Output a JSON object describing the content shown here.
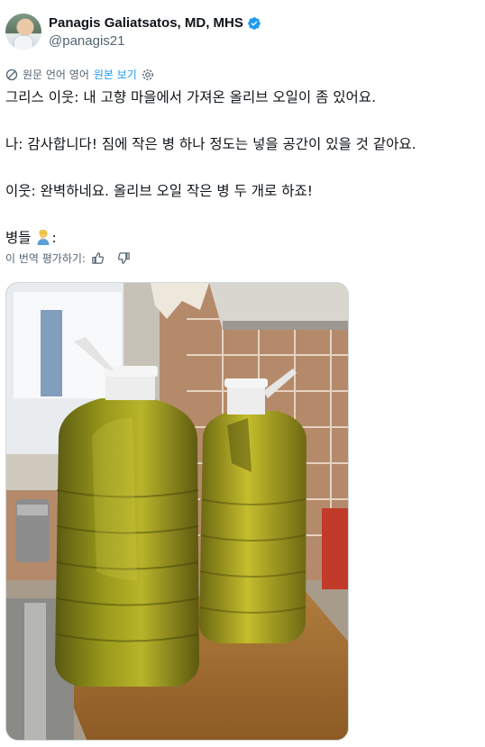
{
  "author": {
    "name": "Panagis Galiatsatos, MD, MHS",
    "handle": "@panagis21",
    "verified_color": "#1d9bf0"
  },
  "translation_bar": {
    "icon": "translate-icon",
    "label": "원문 언어 영어",
    "show_original": "원본 보기",
    "settings_icon": "gear-icon"
  },
  "tweet": {
    "lines": [
      "그리스 이웃: 내 고향 마을에서 가져온 올리브 오일이 좀 있어요.",
      "나: 감사합니다! 짐에 작은 병 하나 정도는 넣을 공간이 있을 것 같아요.",
      "이웃: 완벽하네요. 올리브 오일 작은 병 두 개로 하죠!",
      "병들 ",
      ":"
    ]
  },
  "rating": {
    "label": "이 번역 평가하기:",
    "thumbs_up_icon": "thumbs-up-icon",
    "thumbs_down_icon": "thumbs-down-icon"
  },
  "media": {
    "description_icon": "photo-olive-oil-jugs"
  },
  "colors": {
    "text": "#0f1419",
    "secondary": "#536471",
    "link": "#1d9bf0"
  }
}
